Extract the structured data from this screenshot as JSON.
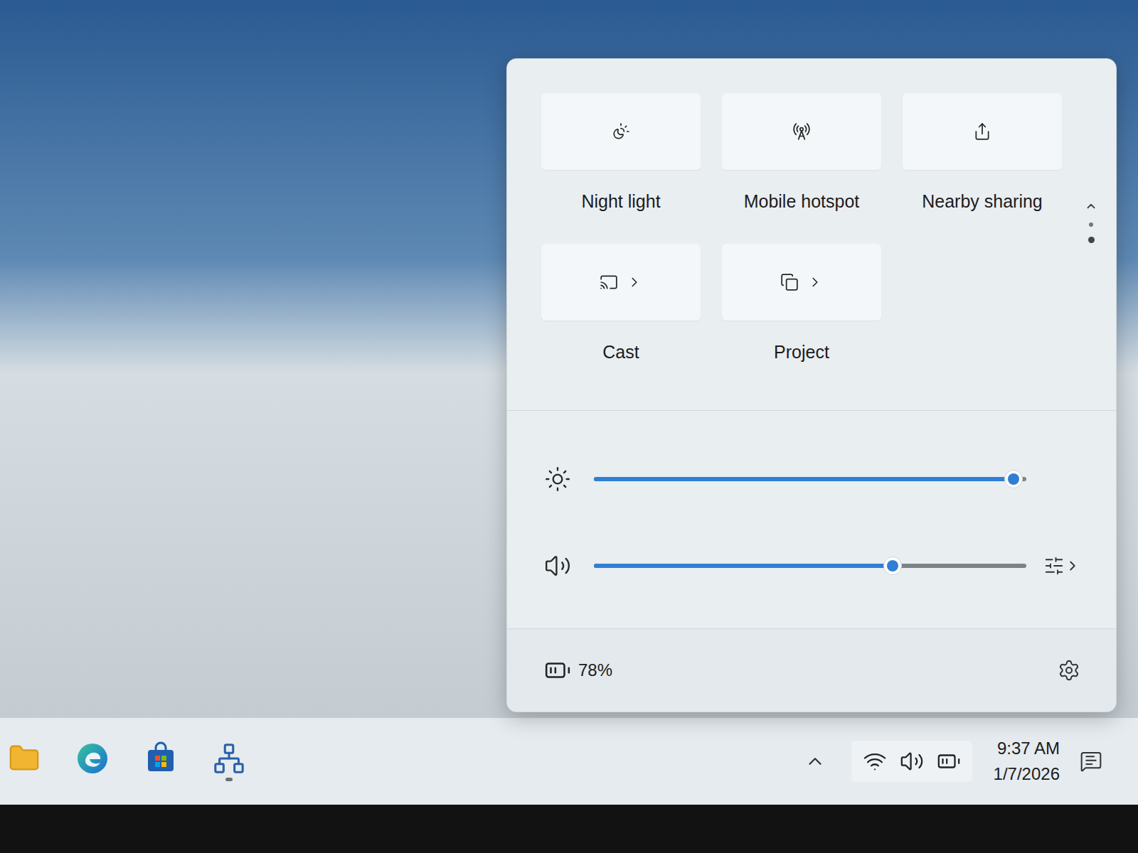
{
  "quick_settings": {
    "tiles": [
      {
        "label": "Night light",
        "icon": "night",
        "on": false,
        "has_chevron": false
      },
      {
        "label": "Mobile hotspot",
        "icon": "hotspot",
        "on": false,
        "has_chevron": false
      },
      {
        "label": "Nearby sharing",
        "icon": "share",
        "on": false,
        "has_chevron": false
      },
      {
        "label": "Cast",
        "icon": "cast",
        "on": false,
        "has_chevron": true
      },
      {
        "label": "Project",
        "icon": "project",
        "on": false,
        "has_chevron": true
      }
    ],
    "page_dots": [
      {
        "selected": false
      },
      {
        "selected": true
      }
    ],
    "sliders": [
      {
        "kind": "brightness",
        "level": 0.97
      },
      {
        "kind": "volume",
        "level": 0.69
      }
    ],
    "battery": {
      "percent": "78%"
    }
  },
  "taskbar": {
    "pinned": [
      {
        "kind": "explorer",
        "active": false
      },
      {
        "kind": "edge",
        "active": false
      },
      {
        "kind": "store",
        "active": false
      },
      {
        "kind": "network",
        "active": true
      }
    ],
    "time": "9:37 AM",
    "date": "1/7/2026"
  }
}
